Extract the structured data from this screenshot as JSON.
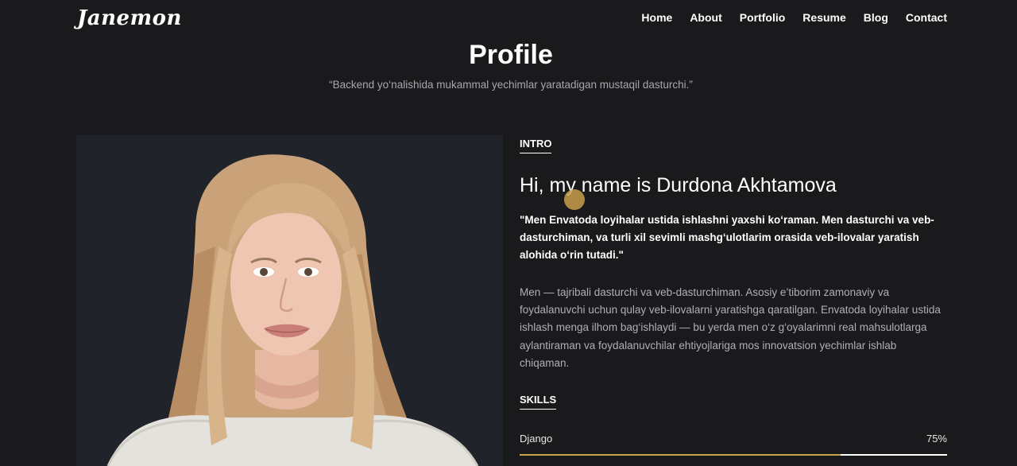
{
  "header": {
    "logo": "Janemon",
    "nav": [
      "Home",
      "About",
      "Portfolio",
      "Resume",
      "Blog",
      "Contact"
    ]
  },
  "hero": {
    "title": "Profile",
    "subtitle": "“Backend yo‘nalishida mukammal yechimlar yaratadigan mustaqil dasturchi.”"
  },
  "intro": {
    "label": "INTRO",
    "heading": "Hi, my name is Durdona Akhtamova",
    "quote": "\"Men Envatoda loyihalar ustida ishlashni yaxshi ko‘raman. Men dasturchi va veb-dasturchiman, va turli xil sevimli mashg‘ulotlarim orasida veb-ilovalar yaratish alohida o‘rin tutadi.\"",
    "bio": "Men — tajribali dasturchi va veb-dasturchiman. Asosiy e’tiborim zamonaviy va foydalanuvchi uchun qulay veb-ilovalarni yaratishga qaratilgan. Envatoda loyihalar ustida ishlash menga ilhom bag‘ishlaydi — bu yerda men o‘z g‘oyalarimni real mahsulotlarga aylantiraman va foydalanuvchilar ehtiyojlariga mos innovatsion yechimlar ishlab chiqaman."
  },
  "skills": {
    "label": "SKILLS",
    "items": [
      {
        "name": "Django",
        "percent_label": "75%",
        "percent": 75
      }
    ]
  },
  "colors": {
    "background": "#1a1a1c",
    "accent": "#c9a04c",
    "muted_text": "#b0b0b4"
  }
}
